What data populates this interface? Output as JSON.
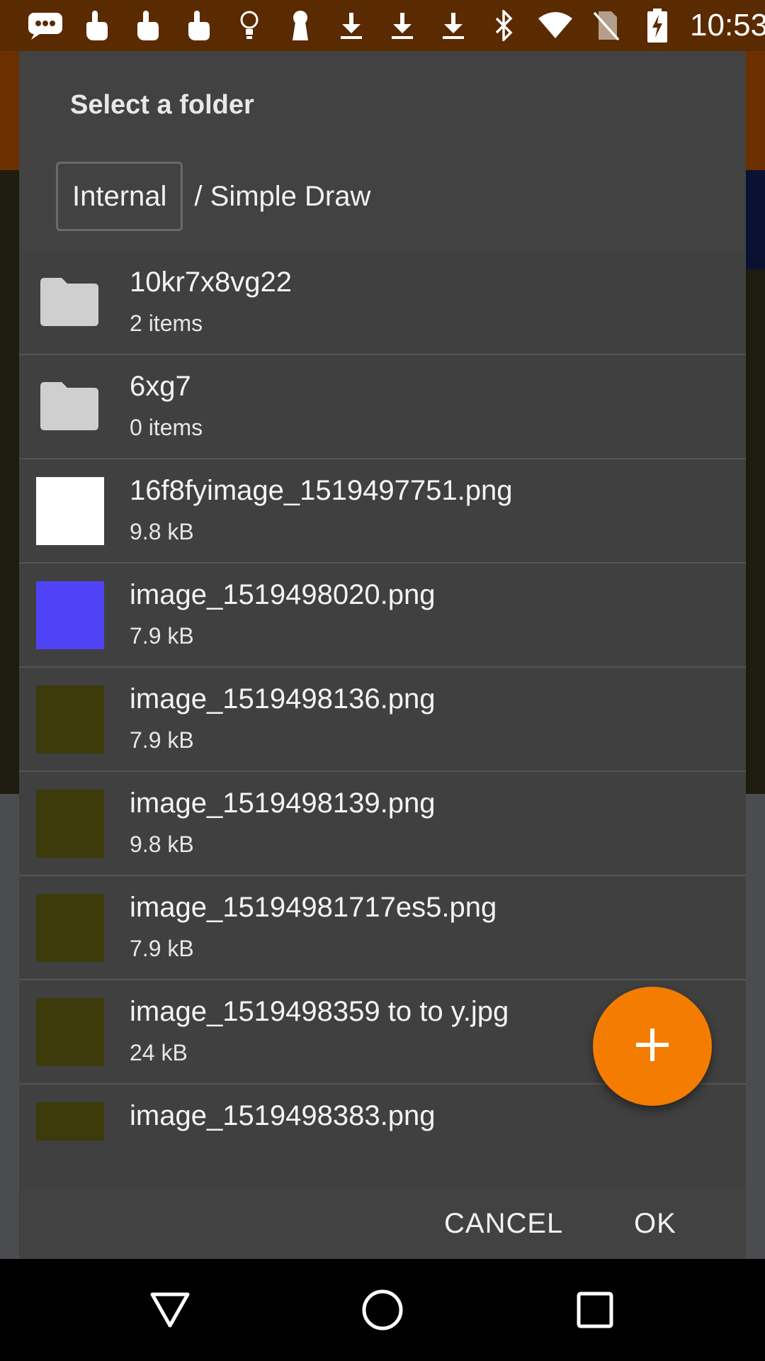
{
  "status_bar": {
    "time": "10:53",
    "icons": [
      "message-icon",
      "touch-icon",
      "touch-icon",
      "touch-icon",
      "bulb-icon",
      "keyhole-icon",
      "download-icon",
      "download-icon",
      "download-icon",
      "bluetooth-icon",
      "wifi-icon",
      "no-sim-icon",
      "battery-charging-icon"
    ]
  },
  "dialog": {
    "title": "Select a folder",
    "breadcrumb": {
      "root": "Internal",
      "path": "/ Simple Draw"
    },
    "items": [
      {
        "type": "folder",
        "name": "10kr7x8vg22",
        "meta": "2 items"
      },
      {
        "type": "folder",
        "name": "6xg7",
        "meta": "0 items"
      },
      {
        "type": "file",
        "name": "16f8fyimage_1519497751.png",
        "meta": "9.8 kB",
        "thumb_color": "#ffffff"
      },
      {
        "type": "file",
        "name": "image_1519498020.png",
        "meta": "7.9 kB",
        "thumb_color": "#4f43f5"
      },
      {
        "type": "file",
        "name": "image_1519498136.png",
        "meta": "7.9 kB",
        "thumb_color": "#3d3a0c"
      },
      {
        "type": "file",
        "name": "image_1519498139.png",
        "meta": "9.8 kB",
        "thumb_color": "#3d3a0c"
      },
      {
        "type": "file",
        "name": "image_15194981717es5.png",
        "meta": "7.9 kB",
        "thumb_color": "#3d3a0c"
      },
      {
        "type": "file",
        "name": "image_1519498359 to to y.jpg",
        "meta": "24 kB",
        "thumb_color": "#3d3a0c"
      },
      {
        "type": "file",
        "name": "image_1519498383.png",
        "meta": "",
        "thumb_color": "#3d3a0c"
      }
    ],
    "fab_icon": "plus-icon",
    "cancel_label": "CANCEL",
    "ok_label": "OK"
  },
  "colors": {
    "accent": "#f47c00",
    "dialog_bg": "#424242",
    "status_bar": "#5a2a00"
  },
  "nav_bar": {
    "icons": [
      "back-icon",
      "home-icon",
      "recents-icon"
    ]
  }
}
